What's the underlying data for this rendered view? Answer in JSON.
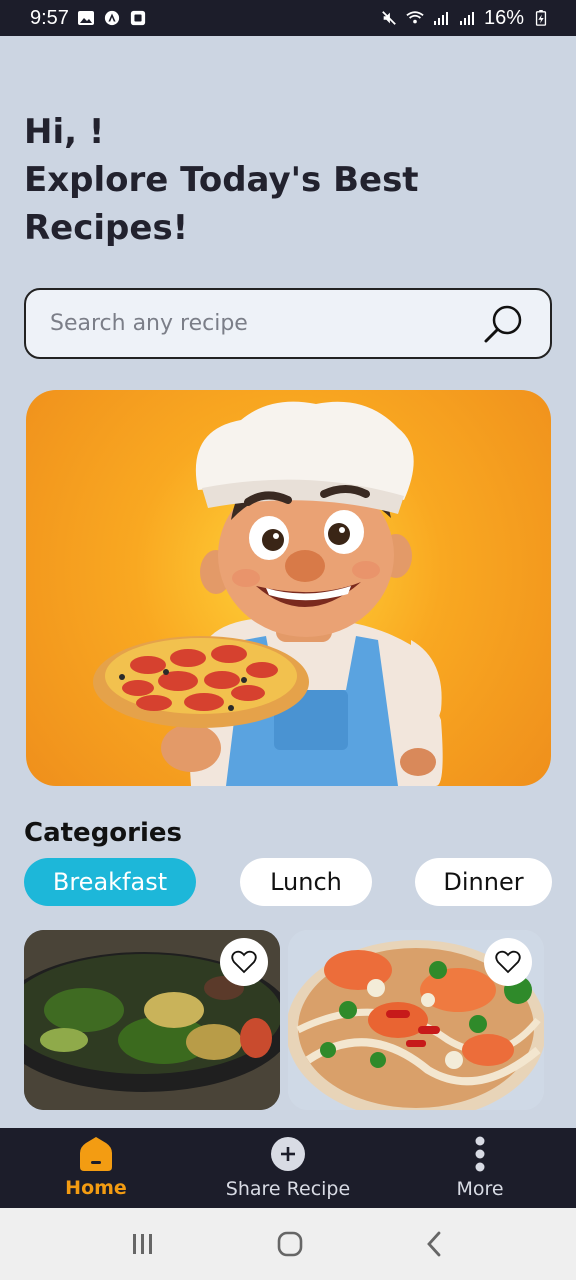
{
  "status_bar": {
    "time": "9:57",
    "battery": "16%"
  },
  "greeting": {
    "line1": "Hi, !",
    "line2": "Explore Today's Best Recipes!"
  },
  "search": {
    "placeholder": "Search any recipe"
  },
  "categories": {
    "title": "Categories",
    "items": [
      {
        "label": "Breakfast",
        "active": true
      },
      {
        "label": "Lunch",
        "active": false
      },
      {
        "label": "Dinner",
        "active": false
      }
    ]
  },
  "bottom_nav": {
    "items": [
      {
        "label": "Home",
        "icon": "home-icon",
        "active": true
      },
      {
        "label": "Share Recipe",
        "icon": "plus-circle-icon",
        "active": false
      },
      {
        "label": "More",
        "icon": "more-vertical-icon",
        "active": false
      }
    ]
  },
  "colors": {
    "accent": "#1db7d9",
    "nav_active": "#f39c12",
    "background": "#ccd5e2",
    "dark": "#1c1d2a"
  }
}
